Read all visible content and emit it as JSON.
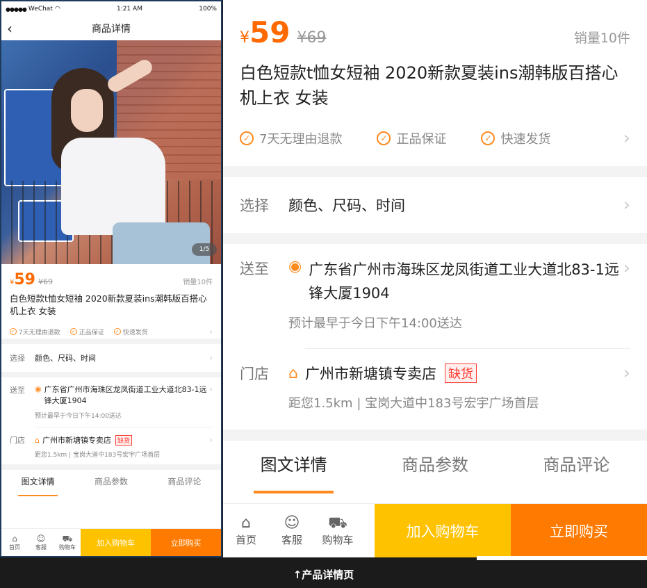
{
  "status": {
    "carrier": "WeChat",
    "time": "1:21 AM",
    "battery": "100%"
  },
  "nav": {
    "title": "商品详情"
  },
  "gallery": {
    "pager": "1/5"
  },
  "product": {
    "currency": "¥",
    "price": "59",
    "old_price": "¥69",
    "sales": "销量10件",
    "title": "白色短款t恤女短袖 2020新款夏装ins潮韩版百搭心机上衣 女装",
    "guarantees": [
      "7天无理由退款",
      "正品保证",
      "快速发货"
    ]
  },
  "select": {
    "label": "选择",
    "value": "颜色、尺码、时间"
  },
  "shipping": {
    "label": "送至",
    "address": "广东省广州市海珠区龙凤街道工业大道北83-1远锋大厦1904",
    "eta": "预计最早于今日下午14:00送达"
  },
  "store": {
    "label": "门店",
    "name": "广州市新塘镇专卖店",
    "badge": "缺货",
    "distance": "距您1.5km",
    "store_address": "宝岗大道中183号宏宇广场首层"
  },
  "tabs": [
    "图文详情",
    "商品参数",
    "商品评论"
  ],
  "bottom": {
    "icons": [
      {
        "label": "首页",
        "icon": "home-icon"
      },
      {
        "label": "客服",
        "icon": "chat-icon"
      },
      {
        "label": "购物车",
        "icon": "cart-icon"
      }
    ],
    "add_to_cart": "加入购物车",
    "buy_now": "立即购买"
  },
  "caption": "↑产品详情页",
  "colors": {
    "accent": "#ff7a00",
    "cart": "#ffc200",
    "price": "#ff6a00"
  }
}
